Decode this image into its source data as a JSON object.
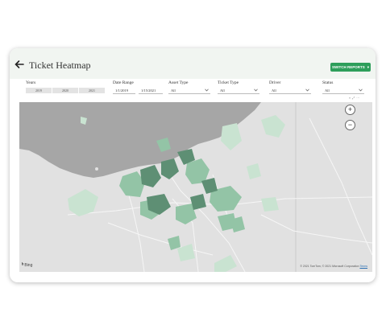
{
  "header": {
    "title": "Ticket Heatmap",
    "switch_reports_label": "SWITCH REPORTS",
    "switch_reports_caret": "▾"
  },
  "filters": {
    "years": {
      "label": "Years",
      "options": [
        "2019",
        "2020",
        "2021"
      ]
    },
    "date_range": {
      "label": "Date Range",
      "start": "1/1/2019",
      "end": "1/15/2021"
    },
    "asset_type": {
      "label": "Asset Type",
      "value": "All"
    },
    "ticket_type": {
      "label": "Ticket Type",
      "value": "All"
    },
    "driver": {
      "label": "Driver",
      "value": "All"
    },
    "status": {
      "label": "Status",
      "value": "All"
    }
  },
  "map": {
    "zoom_in": "+",
    "zoom_out": "−",
    "provider": "Bing",
    "copyright": "© 2021 TomTom, © 2021 Microsoft Corporation",
    "terms": "Terms"
  },
  "colors": {
    "accent": "#2e9e5b",
    "water": "#a6a6a6",
    "land": "#e1e1e1",
    "heat_low": "#c9e3d1",
    "heat_mid": "#93c4a6",
    "heat_high": "#5e8f74"
  }
}
